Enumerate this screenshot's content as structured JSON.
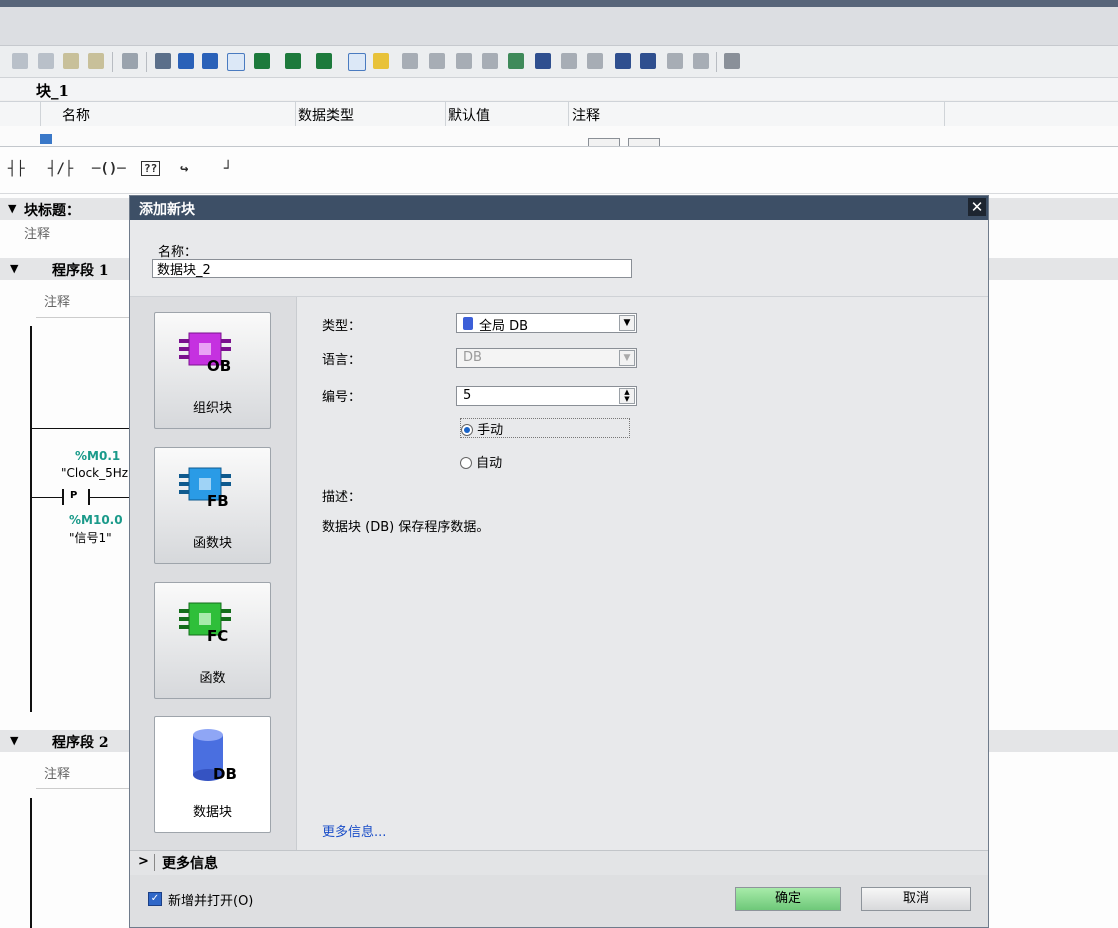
{
  "interface": {
    "block_name": "块_1",
    "columns": {
      "name": "名称",
      "data_type": "数据类型",
      "default": "默认值",
      "comment": "注释"
    }
  },
  "editor": {
    "block_title_label": "块标题：",
    "comment_label": "注释",
    "networks": [
      {
        "label": "程序段 1",
        "comment": "注释"
      },
      {
        "label": "程序段 2",
        "comment": "注释"
      }
    ],
    "operand1_addr": "%M0.1",
    "operand1_name": "\"Clock_5Hz",
    "contact_label": "P",
    "operand2_addr": "%M10.0",
    "operand2_name": "\"信号1\""
  },
  "dialog": {
    "title": "添加新块",
    "close_glyph": "✕",
    "name_label": "名称：",
    "name_value": "数据块_2",
    "blocks": [
      {
        "label": "组织块",
        "code": "OB",
        "color": "#b51fd6"
      },
      {
        "label": "函数块",
        "code": "FB",
        "color": "#1e8fd8"
      },
      {
        "label": "函数",
        "code": "FC",
        "color": "#1fae2a"
      },
      {
        "label": "数据块",
        "code": "DB",
        "color": "#3c5fd8"
      }
    ],
    "type_label": "类型：",
    "type_value": "全局 DB",
    "language_label": "语言：",
    "language_value": "DB",
    "number_label": "编号：",
    "number_value": "5",
    "radio_manual": "手动",
    "radio_auto": "自动",
    "desc_label": "描述：",
    "desc_text": "数据块 (DB) 保存程序数据。",
    "more_link": "更多信息...",
    "more_info_bar": "更多信息",
    "open_checkbox": "新增并打开(O)",
    "ok_button": "确定",
    "cancel_button": "取消",
    "ok_color": "#7fd88a"
  }
}
